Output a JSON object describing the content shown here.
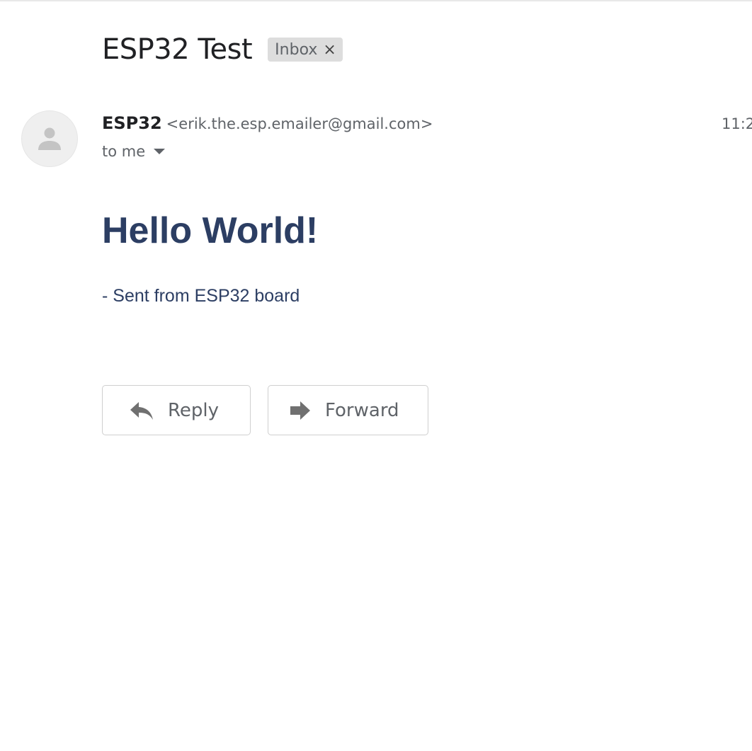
{
  "message": {
    "subject": "ESP32 Test",
    "label": {
      "text": "Inbox",
      "close_glyph": "×"
    },
    "sender": {
      "name": "ESP32",
      "email": "<erik.the.esp.emailer@gmail.com>"
    },
    "time": "11:2",
    "recipient": "to me",
    "body": {
      "heading": "Hello World!",
      "text": "- Sent from ESP32 board"
    }
  },
  "actions": {
    "reply_label": "Reply",
    "forward_label": "Forward"
  },
  "icons": {
    "avatar": "person-icon",
    "reply": "reply-arrow-icon",
    "forward": "forward-arrow-icon",
    "details": "caret-down-icon"
  },
  "colors": {
    "body_text": "#2c3e63",
    "chip_background": "#dddddd",
    "muted_text": "#5f6368"
  }
}
